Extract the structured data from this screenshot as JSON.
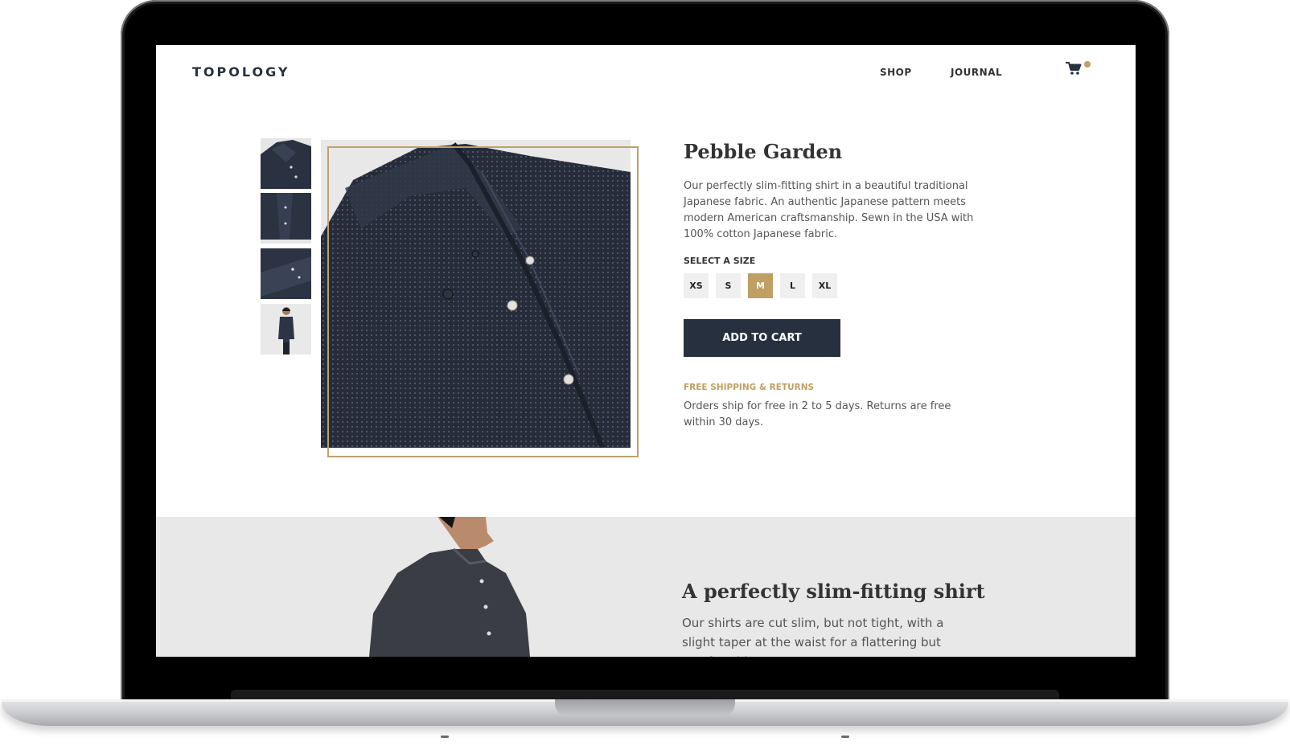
{
  "header": {
    "brand": "TOPOLOGY",
    "nav": [
      "SHOP",
      "JOURNAL"
    ],
    "cart_icon": "cart-icon"
  },
  "product": {
    "title": "Pebble Garden",
    "description": "Our perfectly slim-fitting shirt in a beautiful traditional Japanese fabric. An authentic Japanese pattern meets modern American craftsmanship. Sewn in the USA with 100% cotton Japanese fabric.",
    "size_label": "SELECT A SIZE",
    "sizes": [
      "XS",
      "S",
      "M",
      "L",
      "XL"
    ],
    "selected_size": "M",
    "add_to_cart": "ADD TO CART",
    "shipping_title": "FREE SHIPPING & RETURNS",
    "shipping_text": "Orders ship for free in 2 to 5 days. Returns are free within 30 days."
  },
  "feature": {
    "title": "A perfectly slim-fitting shirt",
    "text": "Our shirts are cut slim, but not tight, with a slight taper at the waist for a flattering but comfortable"
  },
  "colors": {
    "accent": "#bf9f63",
    "navy": "#27303f",
    "band": "#e8e8e8"
  }
}
